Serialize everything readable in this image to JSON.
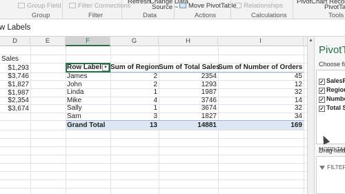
{
  "ribbon": {
    "group_field": "Group Field",
    "group_label": "Group",
    "filter_connections": "Filter Connections",
    "filter_label": "Filter",
    "refresh_partial": "Refresh",
    "change_data_partial": "Change Data",
    "source_partial": "Source ~",
    "data_label": "Data",
    "move_pivottable": "Move PivotTable",
    "actions_label": "Actions",
    "relationships": "Relationships",
    "calculations_label": "Calculations",
    "pivotchart_partial": "PivotChart  Recomm",
    "pivotta_partial": "PivotTa",
    "tools_label": "Tools"
  },
  "formula_bar": {
    "text": "w Labels"
  },
  "columns": [
    "D",
    "E",
    "F",
    "G",
    "H",
    "I"
  ],
  "active_column": "F",
  "left_data": {
    "header": "Sales",
    "values": [
      "$1,293",
      "$3,746",
      "$1,827",
      "$1,987",
      "$2,354",
      "$3,674"
    ]
  },
  "pivot": {
    "headers": [
      "Row Labels",
      "Sum of Region",
      "Sum of Total Sales",
      "Sum of Number of Orders"
    ],
    "dropdown_glyph": "▾",
    "rows": [
      {
        "label": "James",
        "region": "2",
        "sales": "2354",
        "orders": "45"
      },
      {
        "label": "John",
        "region": "2",
        "sales": "1293",
        "orders": "12"
      },
      {
        "label": "Linda",
        "region": "1",
        "sales": "1987",
        "orders": "32"
      },
      {
        "label": "Mike",
        "region": "4",
        "sales": "3746",
        "orders": "14"
      },
      {
        "label": "Sally",
        "region": "1",
        "sales": "3674",
        "orders": "32"
      },
      {
        "label": "Sam",
        "region": "3",
        "sales": "1827",
        "orders": "34"
      }
    ],
    "grand_total": {
      "label": "Grand Total",
      "region": "13",
      "sales": "14881",
      "orders": "169"
    }
  },
  "pane": {
    "title": "PivotTa",
    "choose_fields": "Choose fiel",
    "check_glyph": "✓",
    "fields": [
      "SalesRe",
      "Region",
      "Numbe",
      "Total Sa"
    ],
    "more_tables": "MORE TABL",
    "drag_fields": "Drag fields",
    "filters": "FILTERS"
  }
}
